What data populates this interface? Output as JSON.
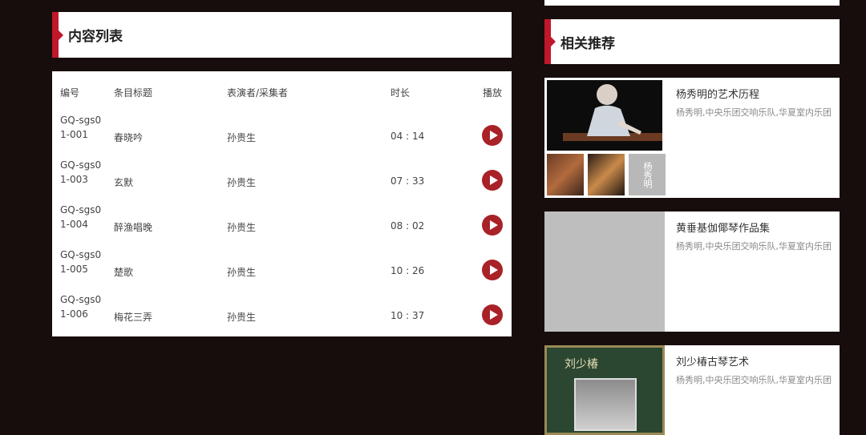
{
  "content_section": {
    "title": "内容列表"
  },
  "table": {
    "headers": {
      "id": "编号",
      "title": "条目标题",
      "performer": "表演者/采集者",
      "duration": "时长",
      "play": "播放"
    },
    "rows": [
      {
        "id": "GQ-sgs01-001",
        "title": "春晓吟",
        "performer": "孙贵生",
        "duration": "04 : 14"
      },
      {
        "id": "GQ-sgs01-003",
        "title": "玄默",
        "performer": "孙贵生",
        "duration": "07 : 33"
      },
      {
        "id": "GQ-sgs01-004",
        "title": "醉渔唱晚",
        "performer": "孙贵生",
        "duration": "08 : 02"
      },
      {
        "id": "GQ-sgs01-005",
        "title": "楚歌",
        "performer": "孙贵生",
        "duration": "10 : 26"
      },
      {
        "id": "GQ-sgs01-006",
        "title": "梅花三弄",
        "performer": "孙贵生",
        "duration": "10 : 37"
      }
    ]
  },
  "related_section": {
    "title": "相关推荐"
  },
  "recommendations": [
    {
      "title": "杨秀明的艺术历程",
      "desc": "杨秀明,中央乐团交响乐队,华夏室内乐团",
      "thumb_text": "杨秀明"
    },
    {
      "title": "黄垂基伽倻琴作品集",
      "desc": "杨秀明,中央乐团交响乐队,华夏室内乐团"
    },
    {
      "title": "刘少椿古琴艺术",
      "desc": "杨秀明,中央乐团交响乐队,华夏室内乐团",
      "thumb_text": "刘少椿"
    }
  ],
  "colors": {
    "accent": "#c0172a",
    "play": "#a82227",
    "background": "#170d0c"
  }
}
